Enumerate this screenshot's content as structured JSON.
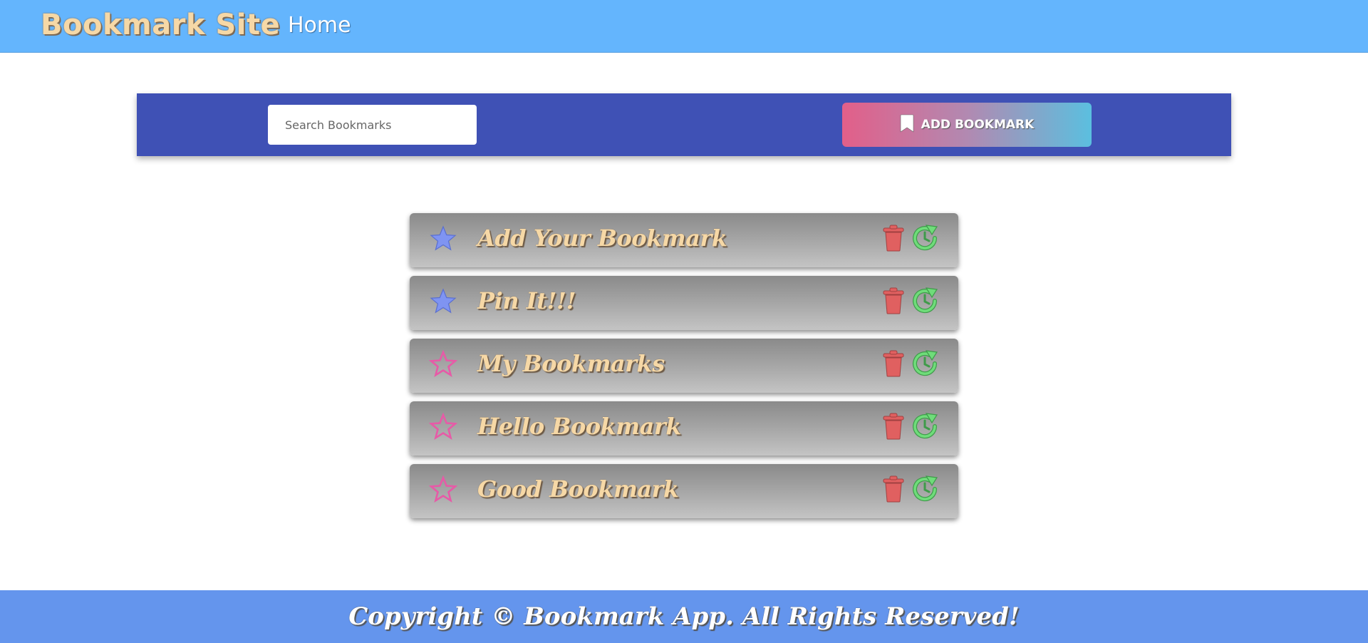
{
  "header": {
    "brand": "Bookmark Site",
    "nav": [
      {
        "label": "Home"
      }
    ]
  },
  "toolbar": {
    "search_placeholder": "Search Bookmarks",
    "add_button_label": "ADD BOOKMARK",
    "add_button_icon": "bookmark-icon"
  },
  "bookmarks": [
    {
      "title": "Add Your Bookmark",
      "pinned": true
    },
    {
      "title": "Pin It!!!",
      "pinned": true
    },
    {
      "title": "My Bookmarks",
      "pinned": false
    },
    {
      "title": "Hello Bookmark",
      "pinned": false
    },
    {
      "title": "Good Bookmark",
      "pinned": false
    }
  ],
  "icons": {
    "pin": "star-icon",
    "delete": "trash-icon",
    "refresh": "refresh-icon"
  },
  "colors": {
    "navbar": "#64b5fd",
    "toolbar": "#3f51b5",
    "footer": "#6495ed",
    "star_pinned": "#7f94f2",
    "star_unpinned": "#e75aa7",
    "trash": "#e06060",
    "refresh": "#6fdc7a",
    "title_text": "#f6d8a6"
  },
  "footer": {
    "text": "Copyright © Bookmark App. All Rights Reserved!"
  }
}
